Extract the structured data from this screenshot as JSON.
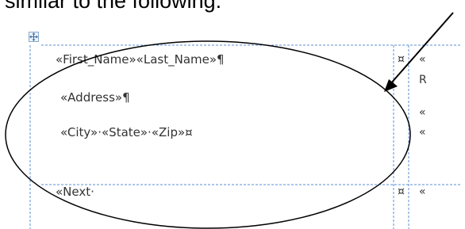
{
  "caption": "similar to the following:",
  "label1": {
    "line1": "«First_Name»«Last_Name»¶",
    "line2": "«Address»¶",
    "line3": "«City»·«State»·«Zip»¤"
  },
  "label2": {
    "line1": "«Next·"
  },
  "right_column": {
    "row1": "«",
    "row2": "R",
    "row3": "«",
    "row4": "«",
    "row5": "«"
  },
  "cell_markers": {
    "marker1": "¤",
    "marker2": "¤"
  },
  "icons": {
    "table_move_handle": "move-arrows-icon",
    "callout_arrow": "arrow-icon",
    "highlight_ellipse": "ellipse-icon"
  }
}
